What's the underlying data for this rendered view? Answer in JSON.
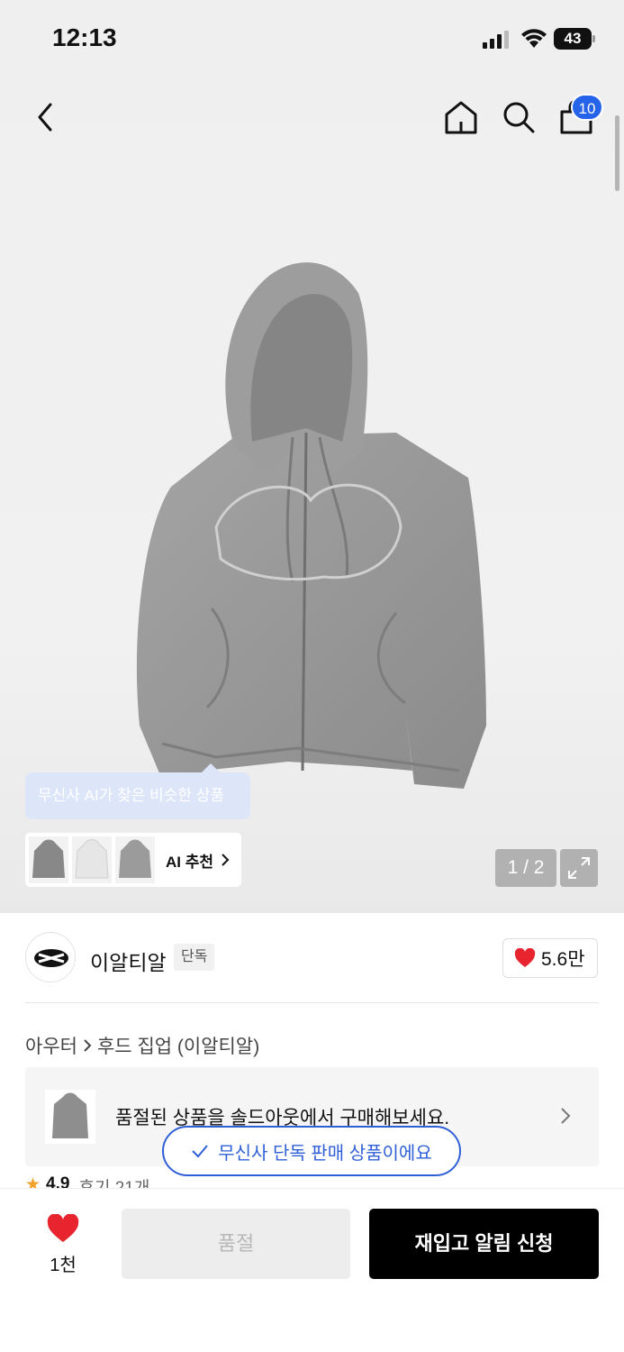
{
  "status_bar": {
    "time": "12:13",
    "battery": "43"
  },
  "header": {
    "cart_count": "10"
  },
  "gallery": {
    "ai_tooltip": "무신사 AI가 찾은 비슷한 상품",
    "ai_recommend_label": "AI 추천",
    "page_indicator": "1 / 2"
  },
  "brand": {
    "name": "이알티알",
    "tag": "단독",
    "likes": "5.6만"
  },
  "breadcrumb": {
    "category": "아우터",
    "subcategory": "후드 집업 (이알티알)"
  },
  "soldout_banner": {
    "text": "품절된 상품을 솔드아웃에서 구매해보세요."
  },
  "exclusive_badge": {
    "text": "무신사 단독 판매 상품이에요"
  },
  "review_peek": {
    "rating": "4.9",
    "reviews": "후기 21개"
  },
  "bottom_bar": {
    "like_count": "1천",
    "soldout_label": "품절",
    "restock_label": "재입고 알림 신청"
  },
  "colors": {
    "accent_blue": "#2f5fd6",
    "badge_blue": "#2563eb",
    "heart_red": "#e8242f",
    "primary_black": "#000000"
  }
}
